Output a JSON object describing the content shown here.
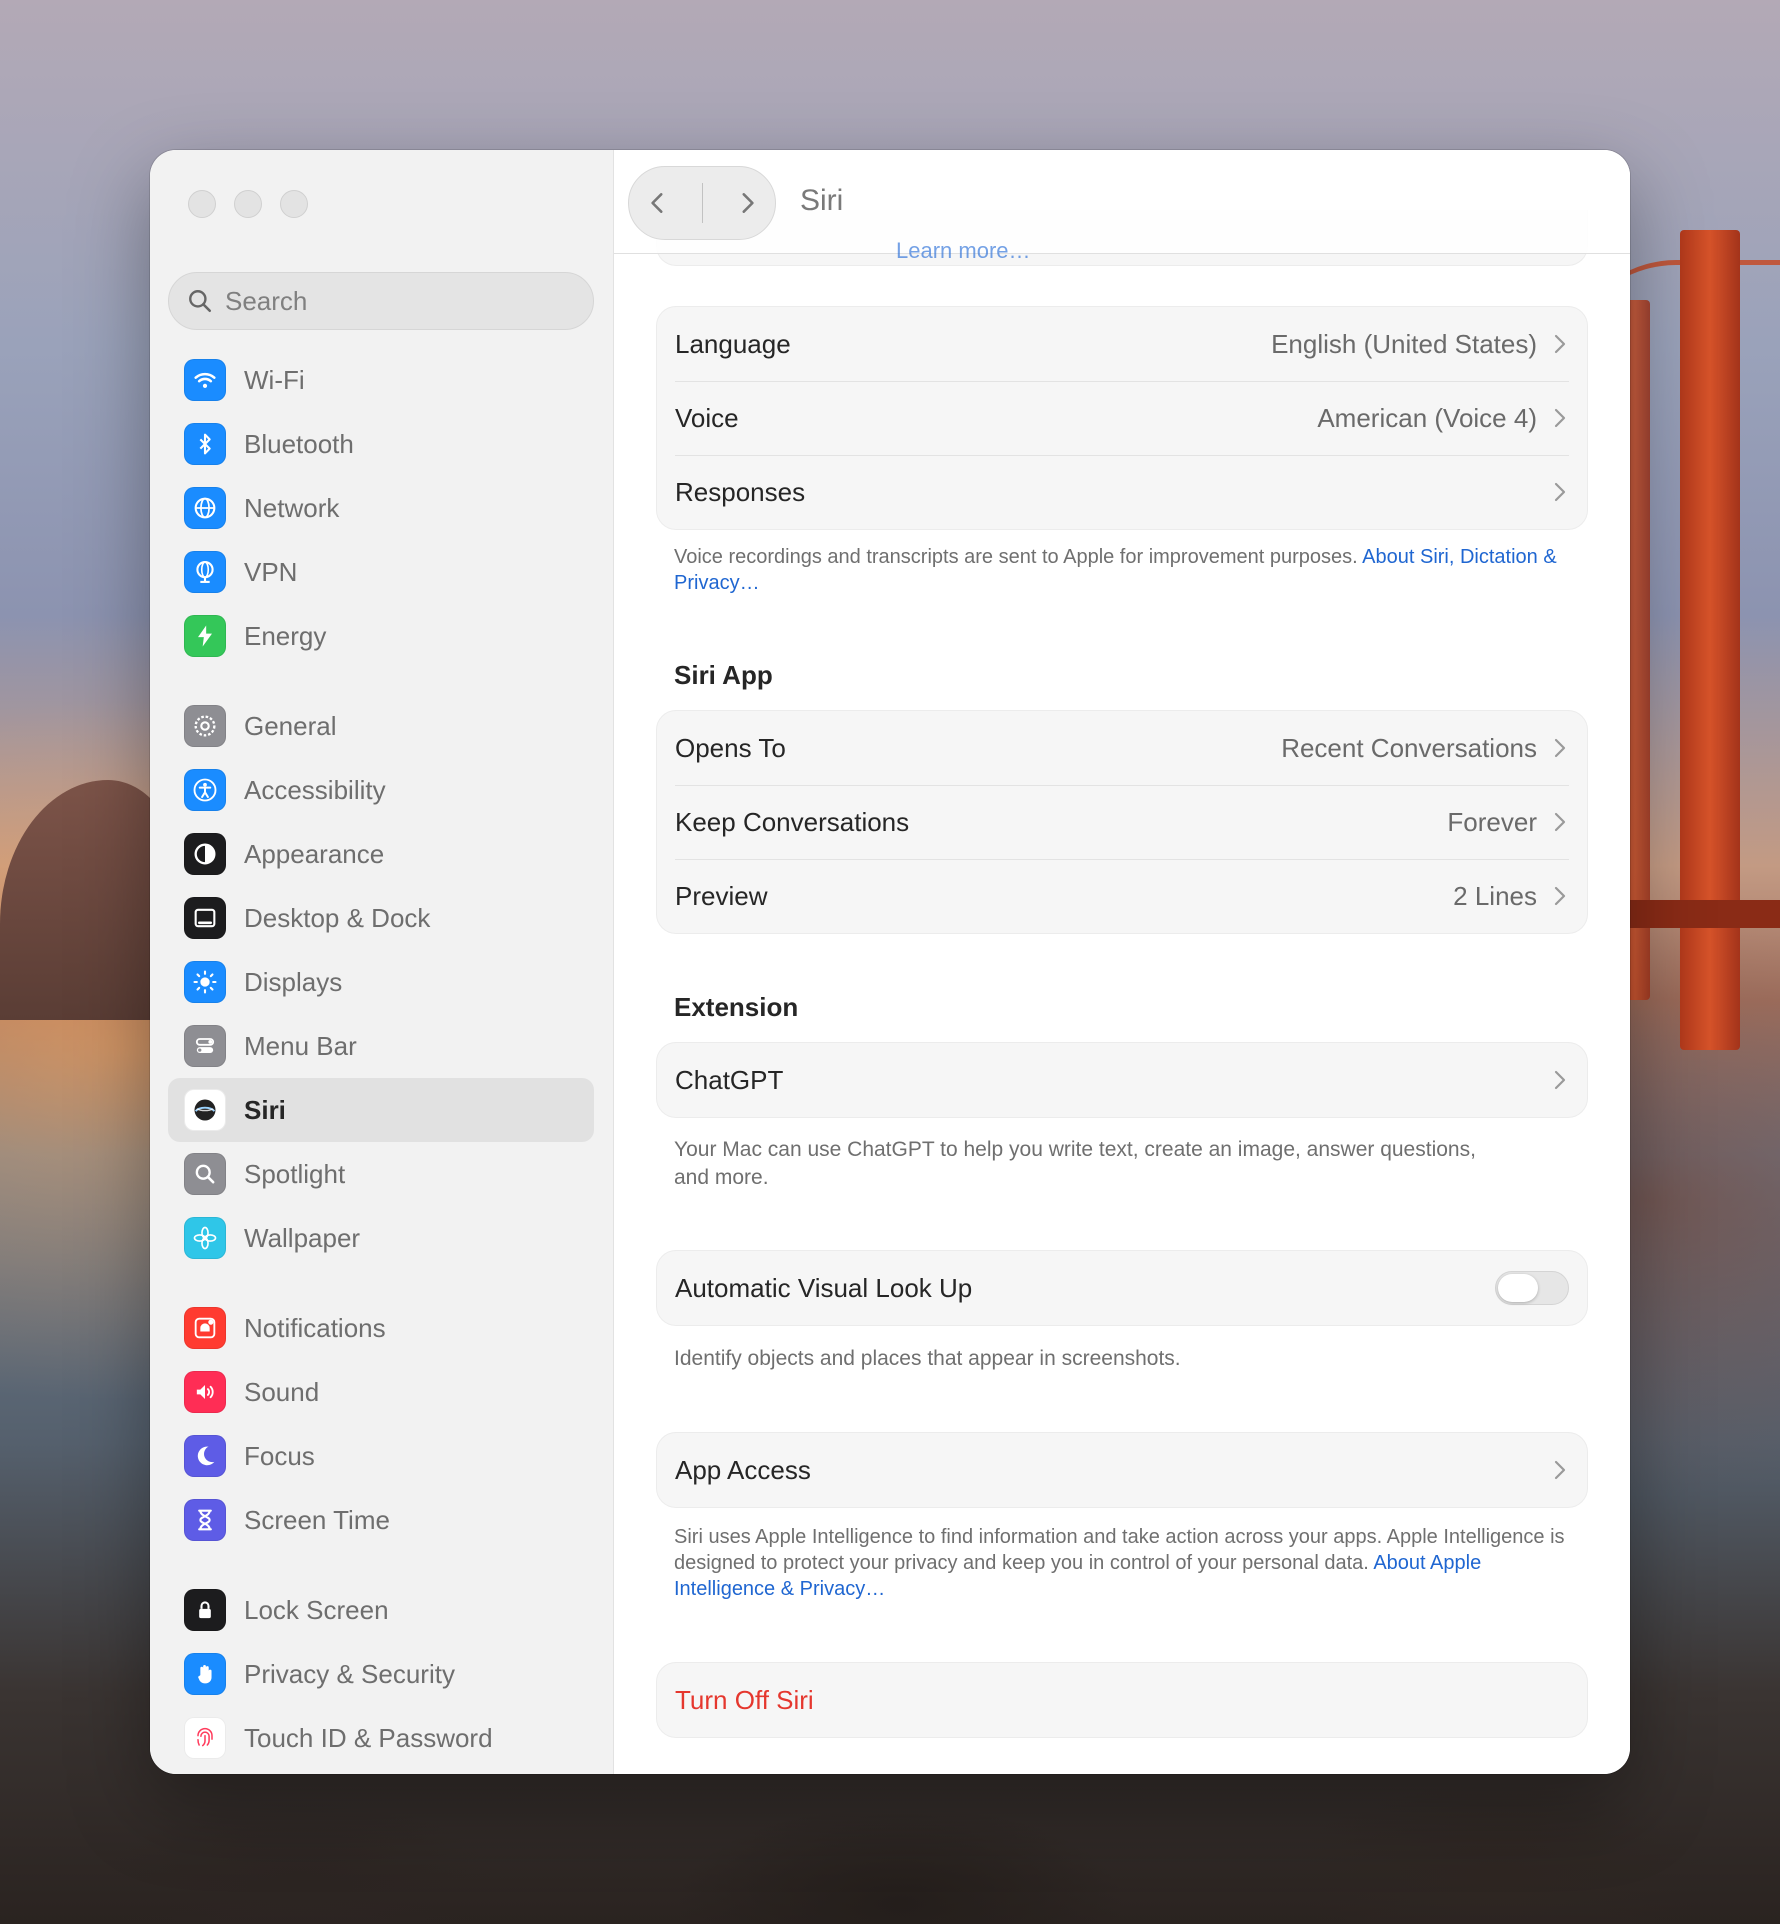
{
  "window": {
    "title": "Siri"
  },
  "sidebar": {
    "search_placeholder": "Search",
    "groups": [
      [
        {
          "label": "Wi-Fi",
          "icon": "wifi-icon",
          "color": "#1a8cff"
        },
        {
          "label": "Bluetooth",
          "icon": "bluetooth-icon",
          "color": "#1a8cff"
        },
        {
          "label": "Network",
          "icon": "globe-icon",
          "color": "#1a8cff"
        },
        {
          "label": "VPN",
          "icon": "vpn-globe-icon",
          "color": "#1a8cff"
        },
        {
          "label": "Energy",
          "icon": "lightning-icon",
          "color": "#34c759"
        }
      ],
      [
        {
          "label": "General",
          "icon": "gear-icon",
          "color": "#8e8e93"
        },
        {
          "label": "Accessibility",
          "icon": "accessibility-icon",
          "color": "#1a8cff"
        },
        {
          "label": "Appearance",
          "icon": "appearance-icon",
          "color": "#1c1c1e"
        },
        {
          "label": "Desktop & Dock",
          "icon": "dock-icon",
          "color": "#1c1c1e"
        },
        {
          "label": "Displays",
          "icon": "sun-icon",
          "color": "#1a8cff"
        },
        {
          "label": "Menu Bar",
          "icon": "menubar-icon",
          "color": "#8e8e93"
        },
        {
          "label": "Siri",
          "icon": "siri-icon",
          "color": "#ffffff",
          "active": true
        },
        {
          "label": "Spotlight",
          "icon": "magnifier-icon",
          "color": "#8e8e93"
        },
        {
          "label": "Wallpaper",
          "icon": "flower-icon",
          "color": "#2fc6e8"
        }
      ],
      [
        {
          "label": "Notifications",
          "icon": "bell-icon",
          "color": "#ff3b30"
        },
        {
          "label": "Sound",
          "icon": "speaker-icon",
          "color": "#ff2d55"
        },
        {
          "label": "Focus",
          "icon": "moon-icon",
          "color": "#5e5ce6"
        },
        {
          "label": "Screen Time",
          "icon": "hourglass-icon",
          "color": "#5e5ce6"
        }
      ],
      [
        {
          "label": "Lock Screen",
          "icon": "lock-icon",
          "color": "#1c1c1e"
        },
        {
          "label": "Privacy & Security",
          "icon": "hand-icon",
          "color": "#1a8cff"
        },
        {
          "label": "Touch ID & Password",
          "icon": "fingerprint-icon",
          "color": "#ffffff"
        }
      ]
    ]
  },
  "main": {
    "ghost_link": "Learn more…",
    "general": [
      {
        "label": "Language",
        "value": "English (United States)"
      },
      {
        "label": "Voice",
        "value": "American (Voice 4)"
      },
      {
        "label": "Responses",
        "value": ""
      }
    ],
    "general_note": "Voice recordings and transcripts are sent to Apple for improvement purposes.",
    "general_note_link": "About Siri, Dictation & Privacy…",
    "siri_app_title": "Siri App",
    "siri_app": [
      {
        "label": "Opens To",
        "value": "Recent Conversations"
      },
      {
        "label": "Keep Conversations",
        "value": "Forever"
      },
      {
        "label": "Preview",
        "value": "2 Lines"
      }
    ],
    "extension_title": "Extension",
    "extension_row": "ChatGPT",
    "extension_note": "Your Mac can use ChatGPT to help you write text, create an image, answer questions, and more.",
    "visual_lookup_label": "Automatic Visual Look Up",
    "visual_lookup_on": false,
    "visual_lookup_note": "Identify objects and places that appear in screenshots.",
    "app_access_label": "App Access",
    "app_access_note": "Siri uses Apple Intelligence to find information and take action across your apps. Apple Intelligence is designed to protect your privacy and keep you in control of your personal data.",
    "app_access_link": "About Apple Intelligence & Privacy…",
    "turn_off_label": "Turn Off Siri",
    "danger_color": "#e5372e",
    "link_color": "#1f66d1"
  }
}
